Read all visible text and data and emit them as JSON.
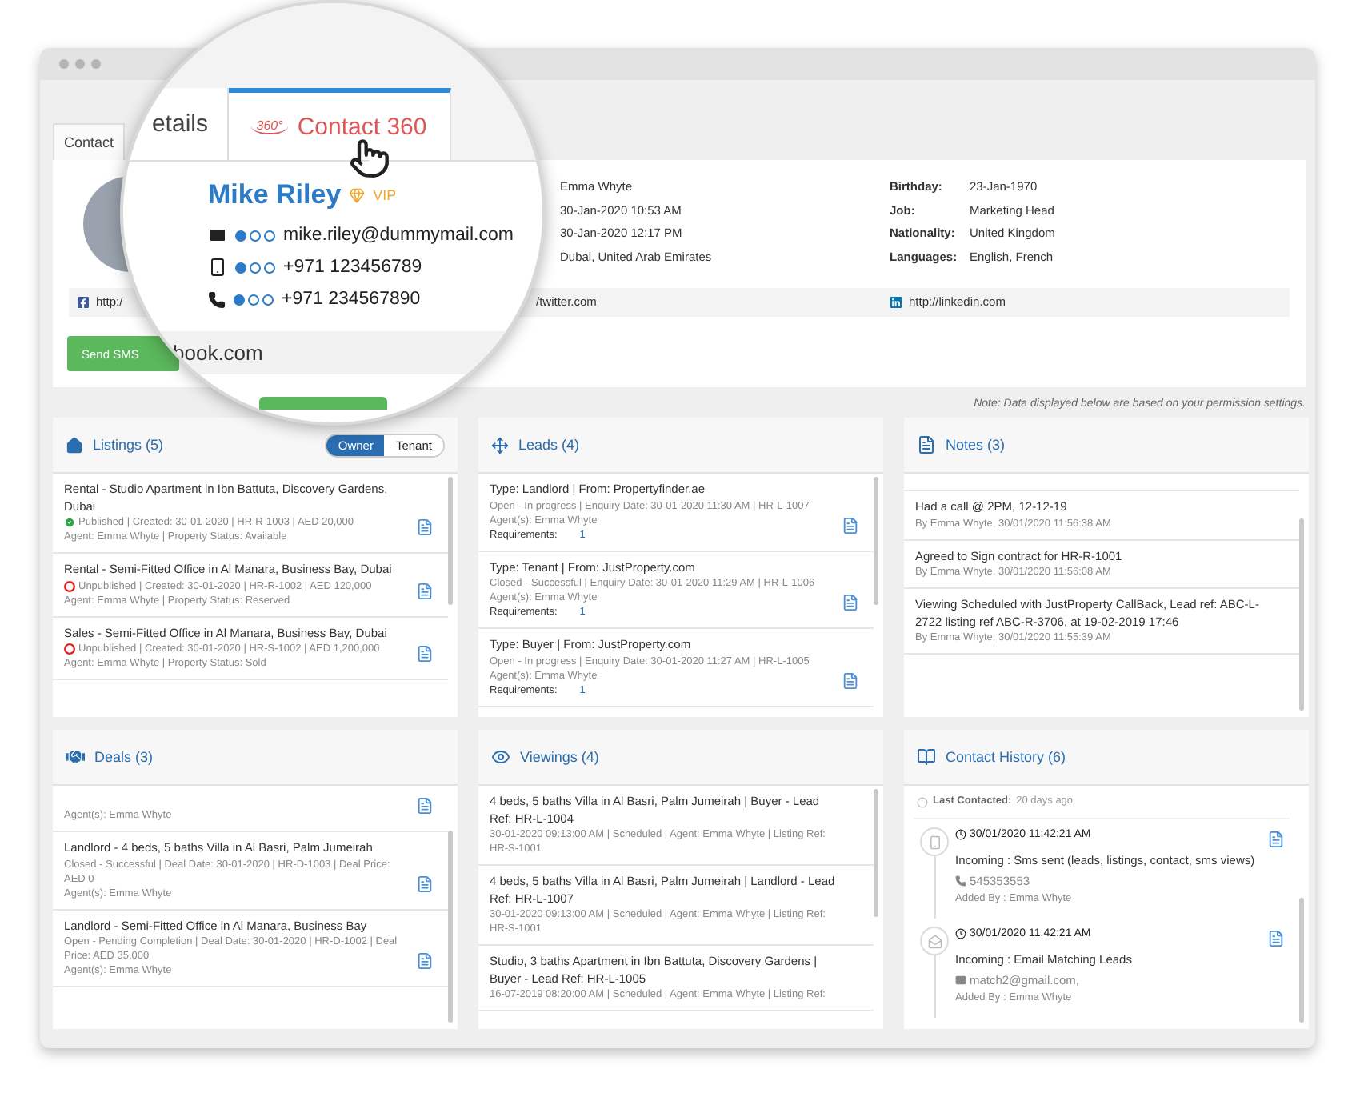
{
  "window": {
    "tabs": [
      {
        "label": "Contact",
        "selected": false
      }
    ]
  },
  "contact": {
    "info": [
      "Emma Whyte",
      "30-Jan-2020 10:53 AM",
      "30-Jan-2020 12:17 PM",
      "Dubai, United Arab Emirates"
    ],
    "details": [
      {
        "label": "Birthday:",
        "value": "23-Jan-1970"
      },
      {
        "label": "Job:",
        "value": "Marketing Head"
      },
      {
        "label": "Nationality:",
        "value": "United Kingdom"
      },
      {
        "label": "Languages:",
        "value": "English, French"
      }
    ],
    "social": [
      {
        "kind": "facebook",
        "url": "http:/"
      },
      {
        "kind": "twitter",
        "url": "/twitter.com"
      },
      {
        "kind": "linkedin",
        "url": "http://linkedin.com"
      }
    ],
    "button": "Send SMS"
  },
  "magnifier": {
    "tabs": [
      {
        "label": "etails",
        "selected": false
      },
      {
        "label": "Contact 360",
        "logo": "360°",
        "selected": true
      }
    ],
    "name": "Mike Riley",
    "badge": "VIP",
    "channels": [
      {
        "kind": "email",
        "value": "mike.riley@dummymail.com",
        "stars": 1
      },
      {
        "kind": "mobile",
        "value": "+971 123456789",
        "stars": 1
      },
      {
        "kind": "phone",
        "value": "+971 234567890",
        "stars": 1
      }
    ],
    "social_text": "book.com"
  },
  "note": "Note: Data displayed below are based on your permission settings.",
  "panels": [
    {
      "kind": "listings",
      "title": "Listings (5)",
      "toggle": [
        {
          "label": "Owner",
          "selected": true
        },
        {
          "label": "Tenant",
          "selected": false
        }
      ],
      "items": [
        {
          "title": "Rental - Studio Apartment in Ibn Battuta, Discovery Gardens, Dubai",
          "status": "Published | Created: 30-01-2020 | HR-R-1003 | AED 20,000",
          "published": true,
          "lines": [
            "Agent: Emma Whyte | Property Status: Available"
          ]
        },
        {
          "title": "Rental - Semi-Fitted Office in Al Manara, Business Bay, Dubai",
          "status": "Unpublished | Created: 30-01-2020 | HR-R-1002 | AED 120,000",
          "published": false,
          "lines": [
            "Agent: Emma Whyte | Property Status: Reserved"
          ]
        },
        {
          "title": "Sales - Semi-Fitted Office in Al Manara, Business Bay, Dubai",
          "status": "Unpublished | Created: 30-01-2020 | HR-S-1002 | AED 1,200,000",
          "published": false,
          "lines": [
            "Agent: Emma Whyte | Property Status: Sold"
          ]
        }
      ]
    },
    {
      "kind": "leads",
      "title": "Leads (4)",
      "items": [
        {
          "title": "Type: Landlord | From: Propertyfinder.ae",
          "lines": [
            "Open - In progress | Enquiry Date: 30-01-2020 11:30 AM | HR-L-1007",
            "Agent(s): Emma Whyte"
          ],
          "requirements": {
            "label": "Requirements:",
            "value": "1"
          }
        },
        {
          "title": "Type: Tenant | From: JustProperty.com",
          "lines": [
            "Closed - Successful | Enquiry Date: 30-01-2020 11:29 AM | HR-L-1006",
            "Agent(s): Emma Whyte"
          ],
          "requirements": {
            "label": "Requirements:",
            "value": "1"
          }
        },
        {
          "title": "Type: Buyer | From: JustProperty.com",
          "lines": [
            "Open - In progress | Enquiry Date: 30-01-2020 11:27 AM | HR-L-1005",
            "Agent(s): Emma Whyte"
          ],
          "requirements": {
            "label": "Requirements:",
            "value": "1"
          }
        }
      ]
    },
    {
      "kind": "notes",
      "title": "Notes (3)",
      "items": [
        {
          "title": "Had a call @ 2PM, 12-12-19",
          "lines": [
            "By Emma Whyte, 30/01/2020 11:56:38 AM"
          ]
        },
        {
          "title": "Agreed to Sign contract for HR-R-1001",
          "lines": [
            "By Emma Whyte, 30/01/2020 11:56:08 AM"
          ]
        },
        {
          "title": "Viewing Scheduled with JustProperty CallBack, Lead ref: ABC-L-2722 listing ref ABC-R-3706, at 19-02-2019 17:46",
          "lines": [
            "By Emma Whyte, 30/01/2020 11:55:39 AM"
          ]
        }
      ]
    },
    {
      "kind": "deals",
      "title": "Deals (3)",
      "items": [
        {
          "lines": [
            "Agent(s): Emma Whyte"
          ]
        },
        {
          "title": "Landlord - 4 beds, 5 baths Villa in Al Basri, Palm Jumeirah",
          "lines": [
            "Closed - Successful | Deal Date: 30-01-2020 | HR-D-1003 | Deal Price: AED 0",
            "Agent(s): Emma Whyte"
          ]
        },
        {
          "title": "Landlord - Semi-Fitted Office in Al Manara, Business Bay",
          "lines": [
            "Open - Pending Completion | Deal Date: 30-01-2020 | HR-D-1002 | Deal Price: AED 35,000",
            "Agent(s): Emma Whyte"
          ]
        }
      ]
    },
    {
      "kind": "viewings",
      "title": "Viewings (4)",
      "items": [
        {
          "title": "4 beds, 5 baths Villa in Al Basri, Palm Jumeirah | Buyer - Lead Ref: HR-L-1004",
          "lines": [
            "30-01-2020 09:13:00 AM | Scheduled | Agent: Emma Whyte | Listing Ref: HR-S-1001"
          ]
        },
        {
          "title": "4 beds, 5 baths Villa in Al Basri, Palm Jumeirah | Landlord - Lead Ref: HR-L-1007",
          "lines": [
            "30-01-2020 09:13:00 AM | Scheduled | Agent: Emma Whyte | Listing Ref: HR-S-1001"
          ]
        },
        {
          "title": "Studio, 3 baths Apartment in Ibn Battuta, Discovery Gardens | Buyer - Lead Ref: HR-L-1005",
          "lines": [
            "16-07-2019 08:20:00 AM | Scheduled | Agent: Emma Whyte | Listing Ref:"
          ]
        }
      ]
    },
    {
      "kind": "history",
      "title": "Contact History (6)",
      "last_contacted": {
        "label": "Last Contacted:",
        "value": "20 days ago"
      },
      "items": [
        {
          "kind": "sms",
          "time": "30/01/2020 11:42:21 AM",
          "title": "Incoming : Sms sent (leads, listings, contact, sms views)",
          "contact": "545353553",
          "added_by": "Added By : Emma Whyte"
        },
        {
          "kind": "email",
          "time": "30/01/2020 11:42:21 AM",
          "title": "Incoming : Email Matching Leads",
          "contact": "match2@gmail.com,",
          "added_by": "Added By : Emma Whyte"
        }
      ]
    }
  ]
}
